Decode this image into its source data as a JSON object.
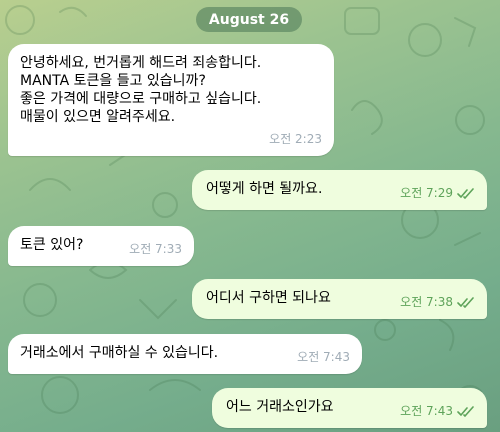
{
  "date_label": "August 26",
  "colors": {
    "incoming_bubble": "#ffffff",
    "outgoing_bubble": "#effdde",
    "outgoing_meta": "#5ea35a",
    "incoming_meta": "#a0acb6"
  },
  "messages": [
    {
      "direction": "incoming",
      "text": "안녕하세요, 번거롭게 해드려 죄송합니다.\nMANTA 토큰을 들고 있습니까?\n좋은 가격에 대량으로 구매하고 싶습니다.\n매물이 있으면 알려주세요.",
      "time": "오전 2:23"
    },
    {
      "direction": "outgoing",
      "text": "어떻게 하면 될까요.",
      "time": "오전 7:29",
      "status_icon": "double-check-icon"
    },
    {
      "direction": "incoming",
      "text": "토큰 있어?",
      "time": "오전 7:33"
    },
    {
      "direction": "outgoing",
      "text": "어디서 구하면 되나요",
      "time": "오전 7:38",
      "status_icon": "double-check-icon"
    },
    {
      "direction": "incoming",
      "text": "거래소에서 구매하실 수 있습니다.",
      "time": "오전 7:43"
    },
    {
      "direction": "outgoing",
      "text": "어느 거래소인가요",
      "time": "오전 7:43",
      "status_icon": "double-check-icon"
    }
  ]
}
